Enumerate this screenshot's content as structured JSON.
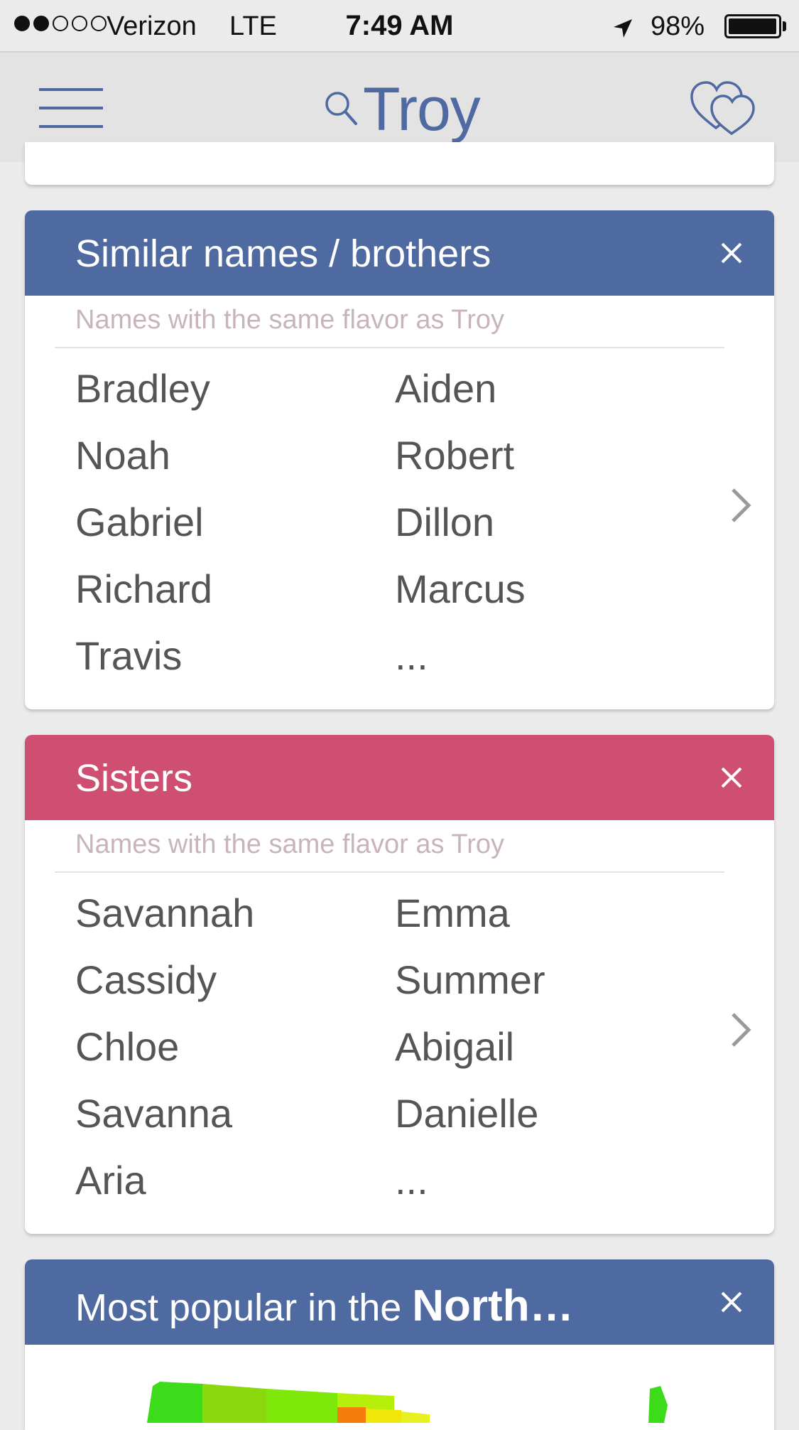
{
  "status_bar": {
    "carrier": "Verizon",
    "network": "LTE",
    "time": "7:49 AM",
    "battery": "98%",
    "battery_level": 0.98,
    "signal_bars_filled": 2,
    "signal_bars_total": 5
  },
  "nav": {
    "title": "Troy",
    "icons": [
      "menu-icon",
      "search-icon",
      "hearts-icon"
    ]
  },
  "cards": {
    "brothers": {
      "title": "Similar names / brothers",
      "subtitle": "Names with the same flavor as Troy",
      "header_color": "#4f6aa0",
      "names_left": [
        "Bradley",
        "Noah",
        "Gabriel",
        "Richard",
        "Travis"
      ],
      "names_right": [
        "Aiden",
        "Robert",
        "Dillon",
        "Marcus",
        "..."
      ]
    },
    "sisters": {
      "title": "Sisters",
      "subtitle": "Names with the same flavor as Troy",
      "header_color": "#cf4f73",
      "names_left": [
        "Savannah",
        "Cassidy",
        "Chloe",
        "Savanna",
        "Aria"
      ],
      "names_right": [
        "Emma",
        "Summer",
        "Abigail",
        "Danielle",
        "..."
      ]
    },
    "popular": {
      "title_prefix": "Most popular in the ",
      "title_bold": "North…",
      "header_color": "#4f6aa0"
    }
  },
  "colors": {
    "accent_blue": "#4f6aa0",
    "accent_pink": "#cf4f73",
    "background": "#ebebeb"
  }
}
